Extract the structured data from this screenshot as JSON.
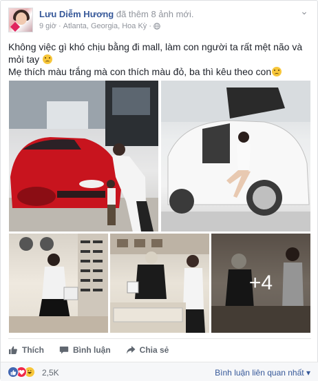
{
  "post": {
    "author": "Lưu Diễm Hương",
    "action": "đã thêm 8 ảnh mới.",
    "time": "9 giờ",
    "location": "Atlanta, Georgia, Hoa Kỳ",
    "separator": "·",
    "line1": "Không việc gì khó chịu bằng đi mall, làm con người ta rất mệt não và mỏi tay",
    "line2": "Mẹ thích màu trắng mà con thích màu đỏ, ba thì kêu theo con",
    "more_photos": "+4"
  },
  "actions": {
    "like": "Thích",
    "comment": "Bình luận",
    "share": "Chia sẻ"
  },
  "reactions": {
    "count": "2,5K",
    "sort_label": "Bình luận liên quan nhất"
  },
  "colors": {
    "link": "#365899",
    "meta": "#90949c",
    "like_blue": "#4267b2",
    "love_red": "#f0284a",
    "haha_yellow": "#f7c63a",
    "car_red": "#c8141e"
  },
  "icons": {
    "privacy": "globe-icon",
    "like": "thumbs-up-icon",
    "comment": "comment-bubble-icon",
    "share": "share-arrow-icon",
    "sort": "chevron-down-icon"
  }
}
